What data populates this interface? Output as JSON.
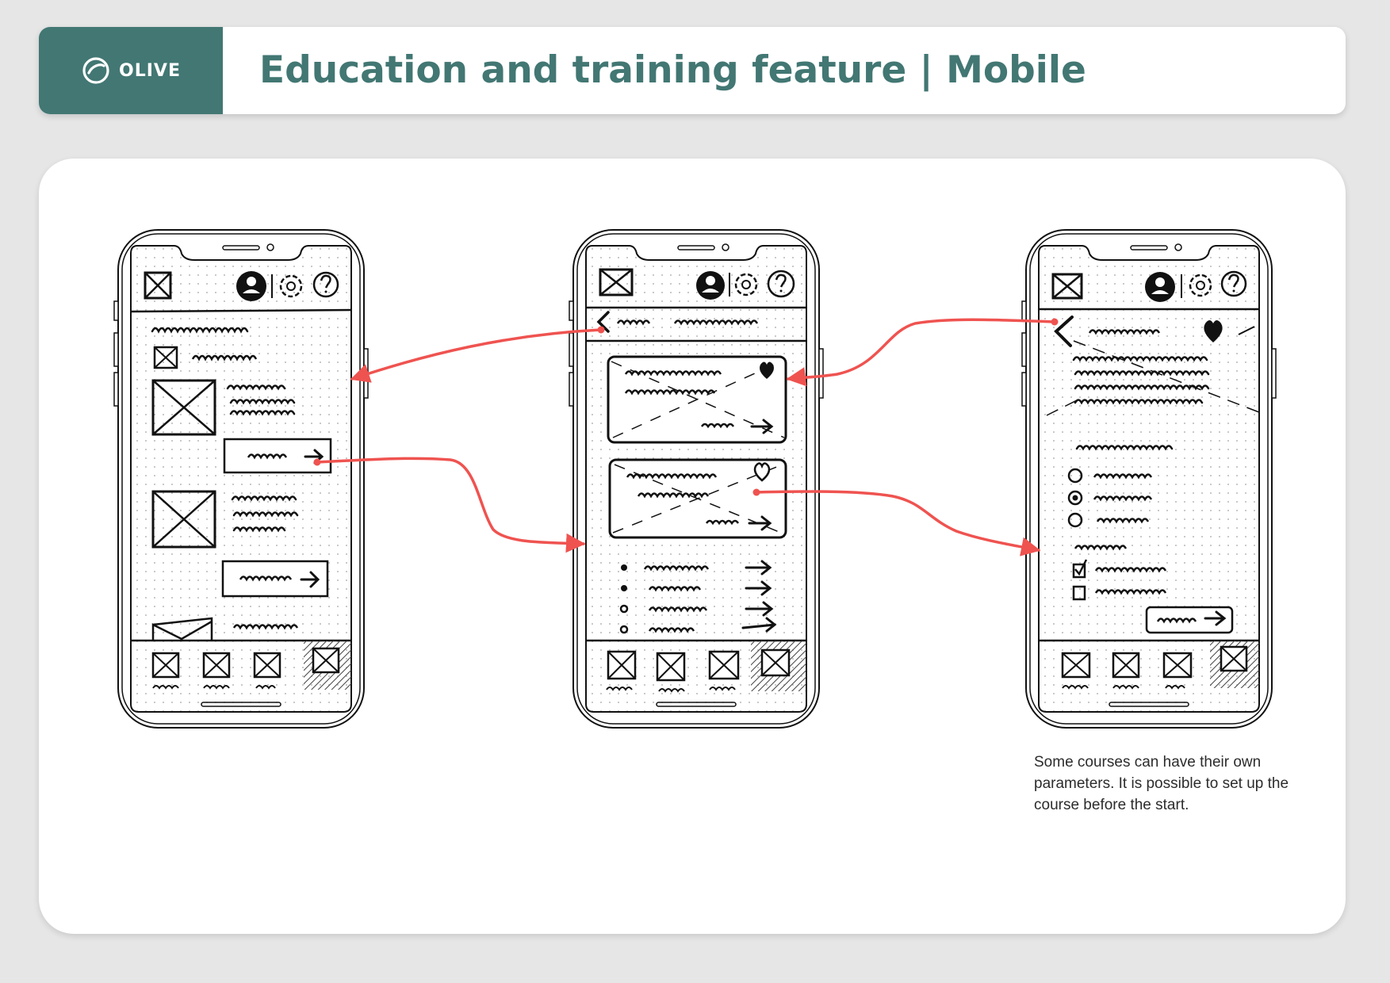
{
  "header": {
    "logo_text": "OLIVE",
    "title": "Education and training feature | Mobile"
  },
  "note": "Some courses can have their own parameters. It is possible to set up the course before the start.",
  "colors": {
    "brand": "#427773",
    "background": "#e6e6e6",
    "panel": "#ffffff",
    "flow_arrow": "#ef5350",
    "sketch_ink": "#111111"
  },
  "icons": [
    "olive-logo-icon",
    "placeholder-image-icon",
    "avatar-icon",
    "gear-icon",
    "help-icon",
    "back-arrow-icon",
    "heart-icon",
    "arrow-right-icon",
    "radio-icon",
    "checkbox-icon"
  ],
  "screens": [
    {
      "id": "course-list",
      "sections": [
        "header-bar",
        "category-filter",
        "course-cards",
        "tab-bar"
      ]
    },
    {
      "id": "course-detail",
      "sections": [
        "header-bar",
        "back-nav",
        "lesson-cards",
        "lesson-list",
        "tab-bar"
      ]
    },
    {
      "id": "course-setup",
      "sections": [
        "header-bar",
        "back-nav",
        "description",
        "radio-options",
        "checkbox-options",
        "start-button",
        "tab-bar"
      ]
    }
  ]
}
